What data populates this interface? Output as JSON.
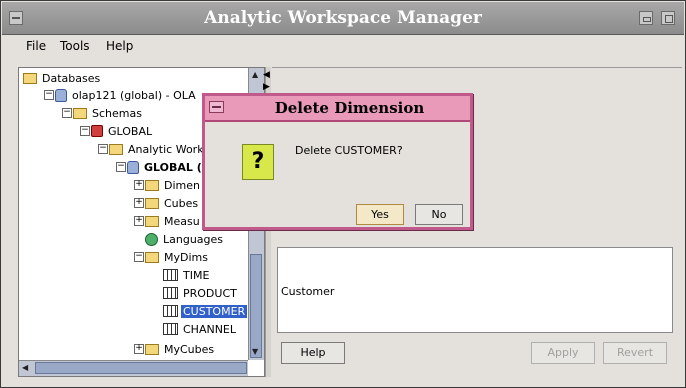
{
  "window": {
    "title": "Analytic Workspace Manager"
  },
  "menu": [
    {
      "label": "File"
    },
    {
      "label": "Tools"
    },
    {
      "label": "Help"
    }
  ],
  "tree": {
    "items": [
      {
        "label": "Databases",
        "icon": "databases-icon"
      },
      {
        "label": "olap121 (global) - OLA",
        "icon": "database-icon"
      },
      {
        "label": "Schemas",
        "icon": "schemas-icon"
      },
      {
        "label": "GLOBAL",
        "icon": "user-icon"
      },
      {
        "label": "Analytic Work",
        "icon": "workspaces-icon"
      },
      {
        "label": "GLOBAL (",
        "icon": "workspace-icon"
      },
      {
        "label": "Dimen",
        "icon": "folder-icon"
      },
      {
        "label": "Cubes",
        "icon": "folder-icon"
      },
      {
        "label": "Measu",
        "icon": "folder-icon"
      },
      {
        "label": "Languages",
        "icon": "globe-icon"
      },
      {
        "label": "MyDims",
        "icon": "folder-icon"
      },
      {
        "label": "TIME",
        "icon": "dimension-icon"
      },
      {
        "label": "PRODUCT",
        "icon": "dimension-icon"
      },
      {
        "label": "CUSTOMER",
        "icon": "dimension-icon"
      },
      {
        "label": "CHANNEL",
        "icon": "dimension-icon"
      },
      {
        "label": "MyCubes",
        "icon": "folder-icon"
      }
    ]
  },
  "panel": {
    "info_text": "Customer",
    "help_label": "Help",
    "apply_label": "Apply",
    "revert_label": "Revert"
  },
  "dialog": {
    "title": "Delete Dimension",
    "message": "Delete CUSTOMER?",
    "yes_label": "Yes",
    "no_label": "No",
    "icon": "question-icon"
  }
}
